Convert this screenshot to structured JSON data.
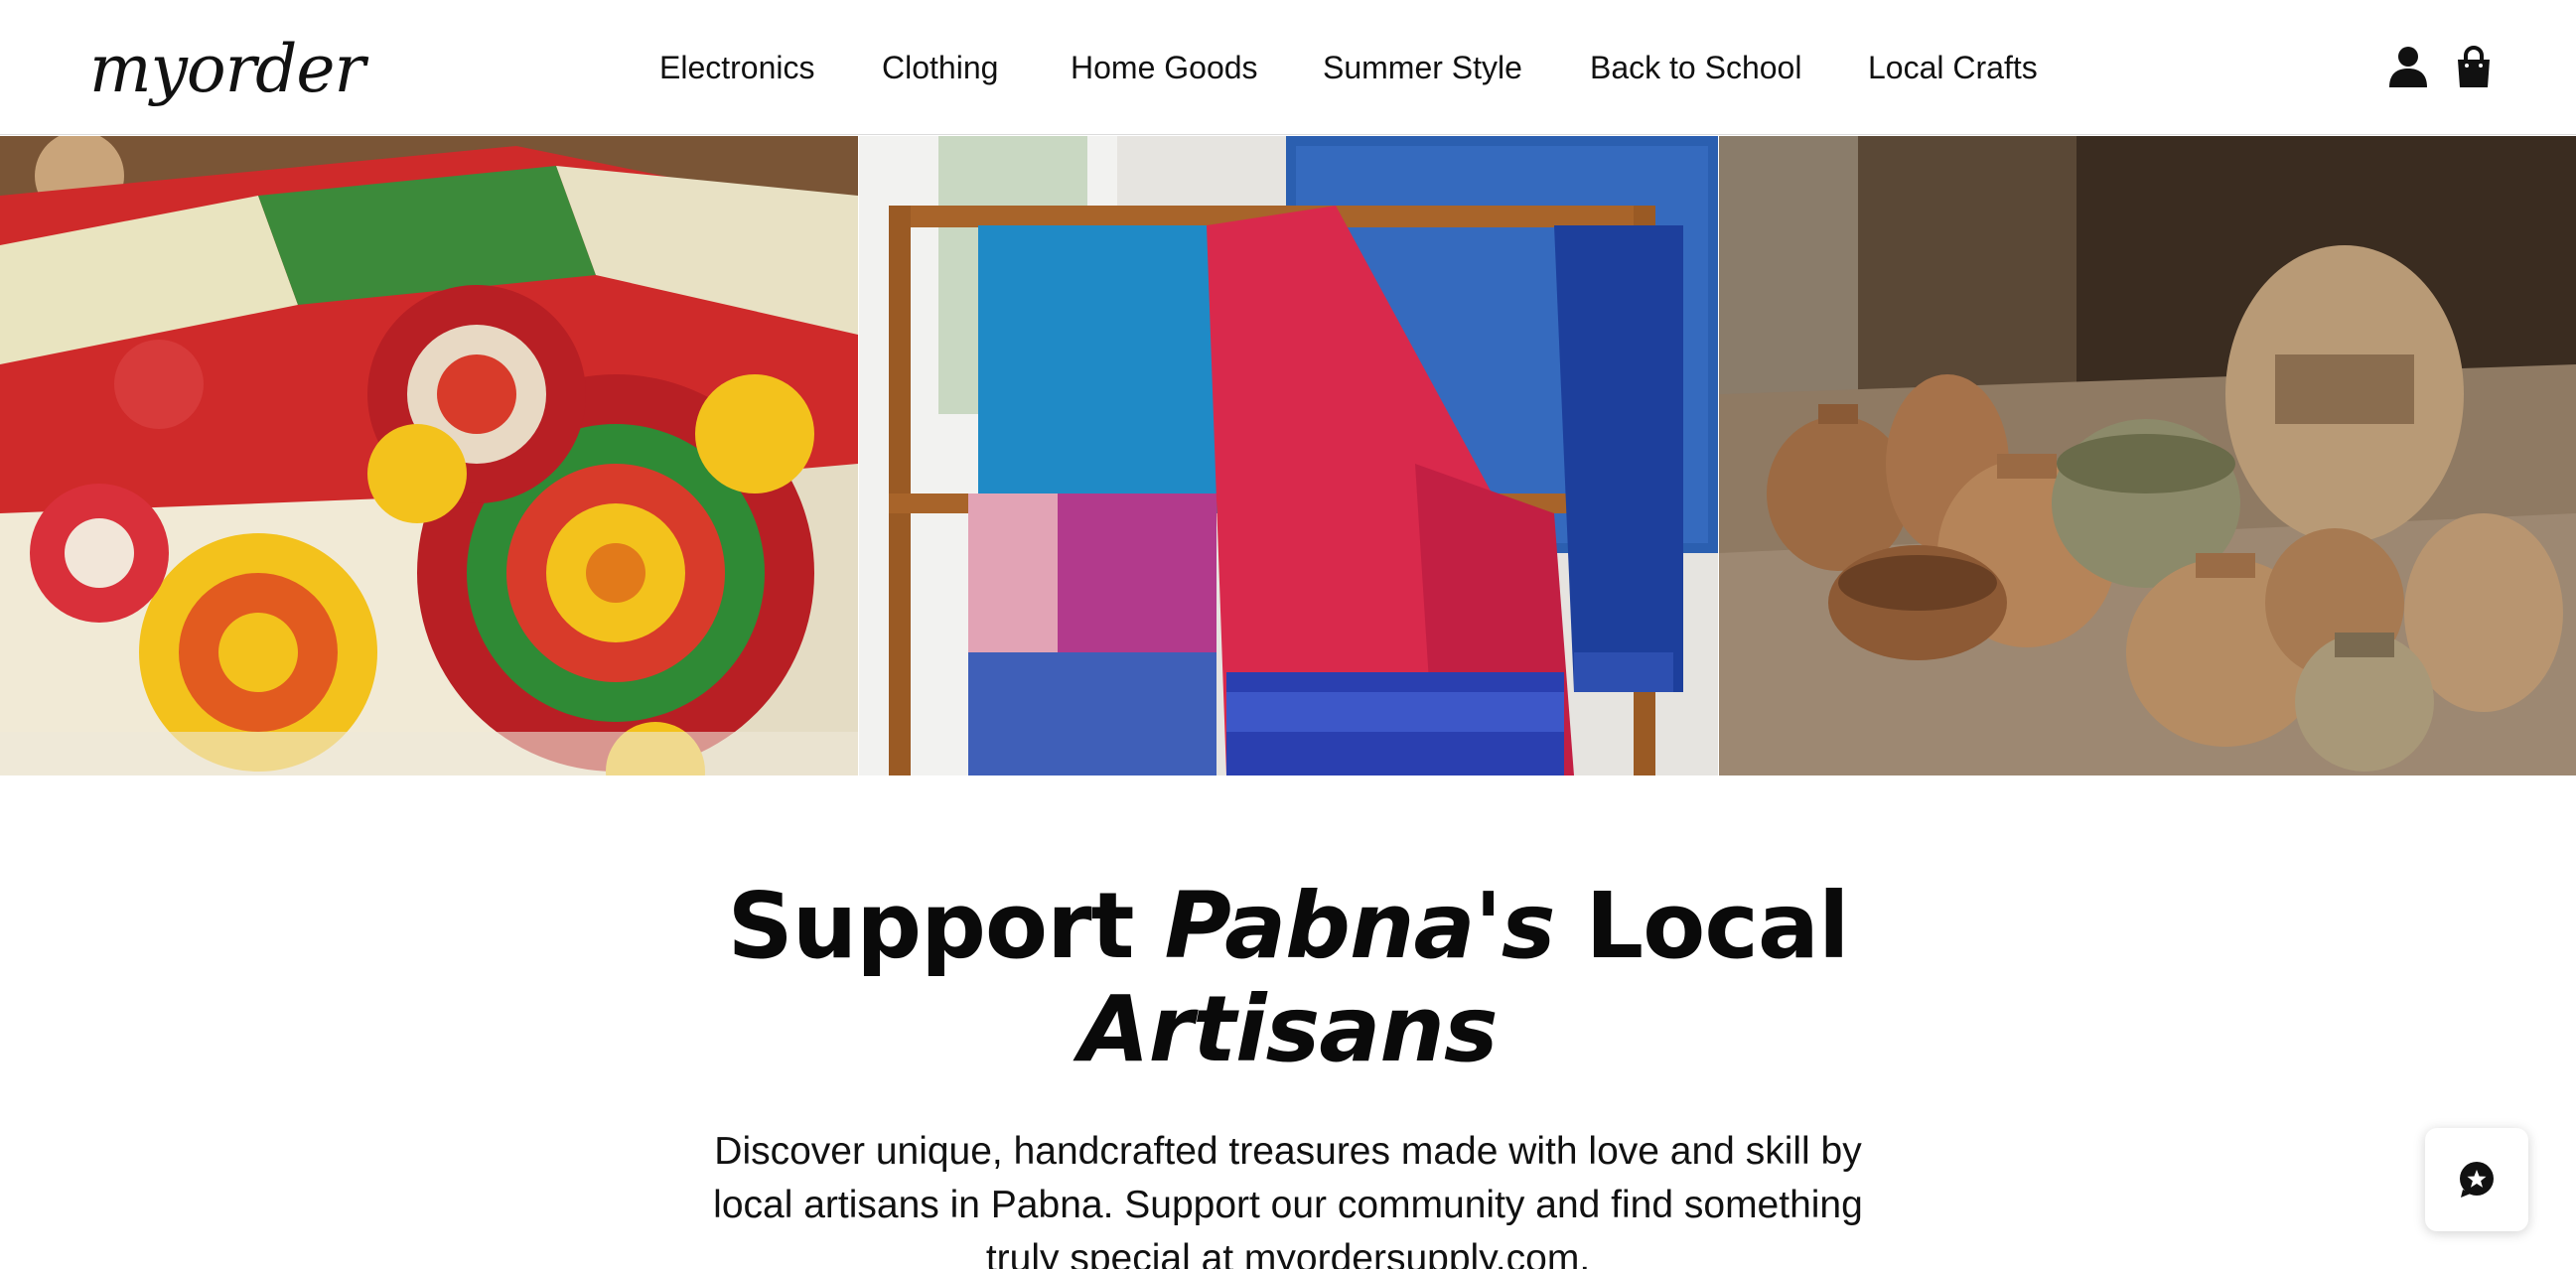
{
  "header": {
    "logo": "myorder",
    "nav": [
      {
        "label": "Electronics"
      },
      {
        "label": "Clothing"
      },
      {
        "label": "Home Goods"
      },
      {
        "label": "Summer Style"
      },
      {
        "label": "Back to School"
      },
      {
        "label": "Local Crafts"
      }
    ],
    "icons": [
      "user-icon",
      "shopping-bag-icon"
    ]
  },
  "hero": {
    "images": [
      "embroidered-textiles-image",
      "woven-saree-loom-image",
      "clay-pottery-image"
    ]
  },
  "main": {
    "headline_part1": "Support ",
    "headline_part2": "Pabna's",
    "headline_part3": " Local",
    "headline_part4": "Artisans",
    "lead": "Discover unique, handcrafted treasures made with love and skill by local artisans in Pabna. Support our community and find something truly special at myordersupply.com."
  },
  "chat": {
    "icon": "chat-star-icon"
  },
  "colors": {
    "text": "#111111",
    "border": "#dcdcdc",
    "background": "#ffffff"
  }
}
